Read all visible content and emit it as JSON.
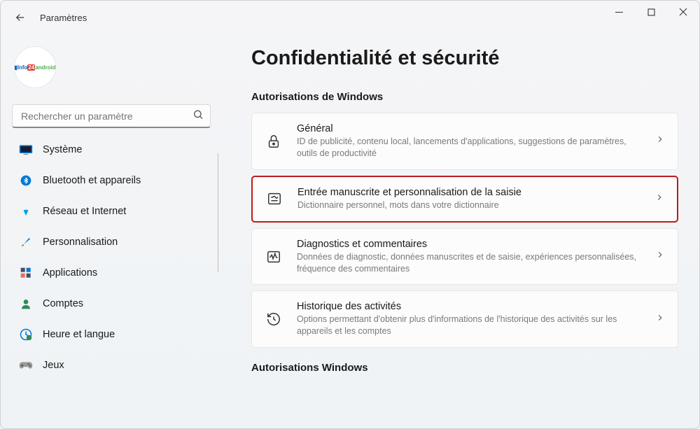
{
  "window": {
    "title": "Paramètres"
  },
  "avatar": {
    "text": "Info 24 android"
  },
  "search": {
    "placeholder": "Rechercher un paramètre"
  },
  "nav": [
    {
      "label": "Système"
    },
    {
      "label": "Bluetooth et appareils"
    },
    {
      "label": "Réseau et Internet"
    },
    {
      "label": "Personnalisation"
    },
    {
      "label": "Applications"
    },
    {
      "label": "Comptes"
    },
    {
      "label": "Heure et langue"
    },
    {
      "label": "Jeux"
    }
  ],
  "page": {
    "title": "Confidentialité et sécurité",
    "section1_heading": "Autorisations de Windows",
    "section2_heading": "Autorisations Windows",
    "cards": [
      {
        "title": "Général",
        "sub": "ID de publicité, contenu local, lancements d'applications, suggestions de paramètres, outils de productivité"
      },
      {
        "title": "Entrée manuscrite et personnalisation de la saisie",
        "sub": "Dictionnaire personnel, mots dans votre dictionnaire"
      },
      {
        "title": "Diagnostics et commentaires",
        "sub": "Données de diagnostic, données manuscrites et de saisie, expériences personnalisées, fréquence des commentaires"
      },
      {
        "title": "Historique des activités",
        "sub": "Options permettant d'obtenir plus d'informations de l'historique des activités sur les appareils et les comptes"
      }
    ]
  }
}
